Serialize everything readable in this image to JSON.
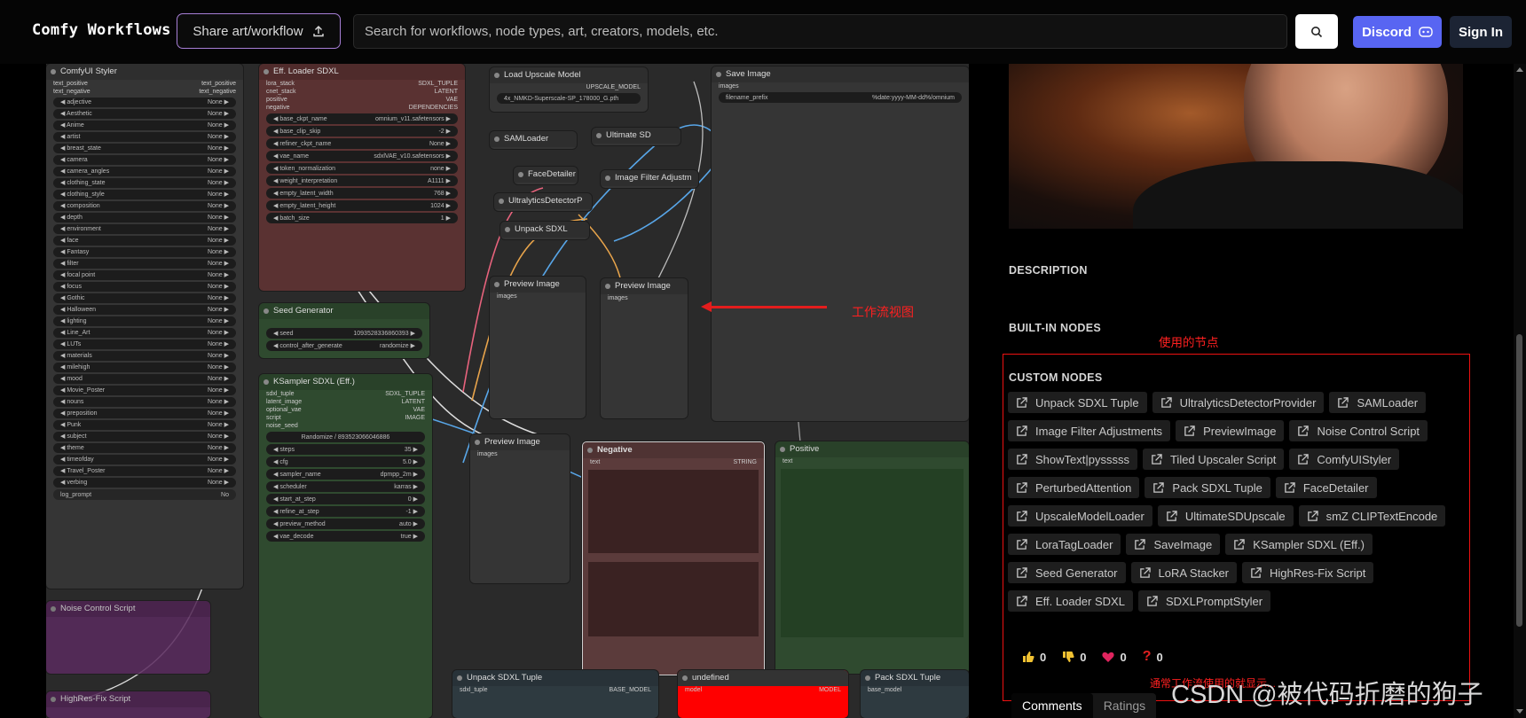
{
  "header": {
    "logo": "Comfy Workflows",
    "share_label": "Share art/workflow",
    "search_placeholder": "Search for workflows, node types, art, creators, models, etc.",
    "discord_label": "Discord",
    "signin_label": "Sign In"
  },
  "canvas": {
    "annotation": "工作流视图",
    "nodes": {
      "styler": "ComfyUI Styler",
      "eff_loader": "Eff. Loader SDXL",
      "load_upscale": "Load Upscale Model",
      "save_image": "Save Image",
      "sam_loader": "SAMLoader (Impact)",
      "ultimate_sd": "Ultimate SD Upscale",
      "face_detailer": "FaceDetailer",
      "image_filter": "Image Filter Adjustm",
      "ultralytics": "UltralyticsDetectorP",
      "unpack_sdxl": "Unpack SDXL Tuple",
      "seed_gen": "Seed Generator",
      "ksampler": "KSampler SDXL (Eff.)",
      "preview1": "Preview Image",
      "preview2": "Preview Image",
      "preview3": "Preview Image",
      "negative": "Negative",
      "positive": "Positive",
      "noise_control": "Noise Control Script",
      "hires_fix": "HighRes-Fix Script",
      "unpack_sdxl2": "Unpack SDXL Tuple",
      "undefined": "undefined",
      "pack_sdxl": "Pack SDXL Tuple"
    },
    "styler_rows": [
      "adjective",
      "Aesthetic",
      "Anime",
      "artist",
      "breast_state",
      "camera",
      "camera_angles",
      "clothing_state",
      "clothing_style",
      "composition",
      "depth",
      "environment",
      "face",
      "Fantasy",
      "filter",
      "focal point",
      "focus",
      "Gothic",
      "Halloween",
      "lighting",
      "Line_Art",
      "LUTs",
      "materials",
      "milehigh",
      "mood",
      "Movie_Poster",
      "nouns",
      "preposition",
      "Punk",
      "subject",
      "theme",
      "timeofday",
      "Travel_Poster",
      "verbing"
    ],
    "styler_value": "None",
    "eff_rows": [
      {
        "k": "base_ckpt_name",
        "v": "omnium_v11.safetensors"
      },
      {
        "k": "base_clip_skip",
        "v": "-2"
      },
      {
        "k": "refiner_ckpt_name",
        "v": "None"
      },
      {
        "k": "vae_name",
        "v": "sdxlVAE_v10.safetensors"
      },
      {
        "k": "token_normalization",
        "v": "none"
      },
      {
        "k": "weight_interpretation",
        "v": "A1111"
      },
      {
        "k": "empty_latent_width",
        "v": "768"
      },
      {
        "k": "empty_latent_height",
        "v": "1024"
      },
      {
        "k": "batch_size",
        "v": "1"
      }
    ],
    "seed_rows": [
      {
        "k": "seed",
        "v": "1093528336860393"
      },
      {
        "k": "control_after_generate",
        "v": "randomize"
      }
    ],
    "ks_rows": [
      {
        "k": "steps",
        "v": "35"
      },
      {
        "k": "cfg",
        "v": "5.0"
      },
      {
        "k": "sampler_name",
        "v": "dpmpp_2m"
      },
      {
        "k": "scheduler",
        "v": "karras"
      },
      {
        "k": "start_at_step",
        "v": "0"
      },
      {
        "k": "refine_at_step",
        "v": "-1"
      },
      {
        "k": "preview_method",
        "v": "auto"
      },
      {
        "k": "vae_decode",
        "v": "true"
      }
    ],
    "ks_seed": "Randomize / 893523066046886"
  },
  "panel": {
    "description_label": "DESCRIPTION",
    "builtin_label": "BUILT-IN NODES",
    "used_nodes_note": "使用的节点",
    "custom_label": "CUSTOM NODES",
    "custom_nodes": [
      "Unpack SDXL Tuple",
      "UltralyticsDetectorProvider",
      "SAMLoader",
      "Image Filter Adjustments",
      "PreviewImage",
      "Noise Control Script",
      "ShowText|pysssss",
      "Tiled Upscaler Script",
      "ComfyUIStyler",
      "PerturbedAttention",
      "Pack SDXL Tuple",
      "FaceDetailer",
      "UpscaleModelLoader",
      "UltimateSDUpscale",
      "smZ CLIPTextEncode",
      "LoraTagLoader",
      "SaveImage",
      "KSampler SDXL (Eff.)",
      "Seed Generator",
      "LoRA Stacker",
      "HighRes-Fix Script",
      "Eff. Loader SDXL",
      "SDXLPromptStyler"
    ],
    "reactions": {
      "like": "0",
      "dislike": "0",
      "heart": "0",
      "question": "0"
    },
    "bottom_note": "通常工作流使用的就显示...",
    "tabs": [
      "Comments",
      "Ratings"
    ],
    "watermark": "CSDN @被代码折磨的狗子"
  }
}
